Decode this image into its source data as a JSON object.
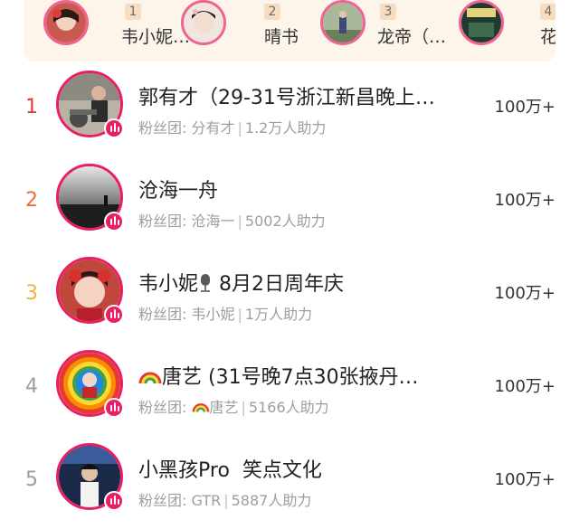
{
  "top_strip": {
    "items": [
      {
        "rank": "1",
        "name": "韦小妮…"
      },
      {
        "rank": "2",
        "name": "晴书"
      },
      {
        "rank": "3",
        "name": "龙帝（…"
      },
      {
        "rank": "4",
        "name": "花"
      }
    ]
  },
  "fan_label": "粉丝团:",
  "list": [
    {
      "rank": "1",
      "title": "郭有才（29-31号浙江新昌晚上…",
      "fan_club": "分有才",
      "support": "1.2万人助力",
      "hot": "100万+",
      "rank_color": "#e53935"
    },
    {
      "rank": "2",
      "title": "沧海一舟",
      "fan_club": "沧海一",
      "support": "5002人助力",
      "hot": "100万+",
      "rank_color": "#ef6c3a"
    },
    {
      "rank": "3",
      "title": "8月2日周年庆",
      "title_prefix": "韦小妮",
      "fan_club": "韦小妮",
      "support": "1万人助力",
      "hot": "100万+",
      "rank_color": "#f2b33d"
    },
    {
      "rank": "4",
      "title": "唐艺 (31号晚7点30张掖丹…",
      "fan_club": "唐艺",
      "support": "5166人助力",
      "hot": "100万+",
      "rank_color": "#9e9e9e"
    },
    {
      "rank": "5",
      "title": "小黑孩Pro  笑点文化",
      "fan_club": "GTR",
      "support": "5887人助力",
      "hot": "100万+",
      "rank_color": "#9e9e9e"
    }
  ],
  "icons": {
    "live": "live-equalizer-icon",
    "rainbow": "rainbow-emoji-icon",
    "mic": "microphone-emoji-icon"
  }
}
